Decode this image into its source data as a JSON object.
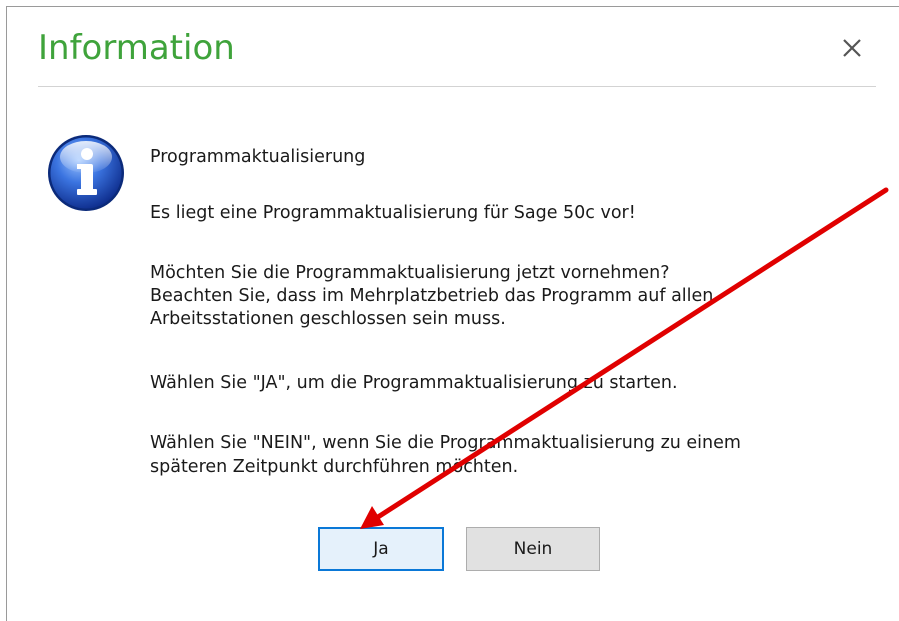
{
  "dialog": {
    "title": "Information",
    "close_label": "×",
    "icon": "info-icon"
  },
  "message": {
    "heading": "Programmaktualisierung",
    "line1": "Es liegt eine Programmaktualisierung für Sage 50c vor!",
    "question_lines": [
      "Möchten Sie die Programmaktualisierung jetzt vornehmen?",
      "Beachten Sie, dass im Mehrplatzbetrieb das Programm auf allen",
      "Arbeitsstationen geschlossen sein muss."
    ],
    "yes_hint": "Wählen Sie \"JA\", um die Programmaktualisierung zu starten.",
    "no_hint_lines": [
      "Wählen Sie \"NEIN\", wenn Sie die Programmaktualisierung zu einem",
      "späteren Zeitpunkt durchführen möchten."
    ]
  },
  "buttons": {
    "yes_label": "Ja",
    "no_label": "Nein"
  },
  "colors": {
    "title": "#3fa33b",
    "annotation_arrow": "#e00000",
    "default_button_border": "#0a78d7",
    "icon_blue": "#1f55c9"
  }
}
